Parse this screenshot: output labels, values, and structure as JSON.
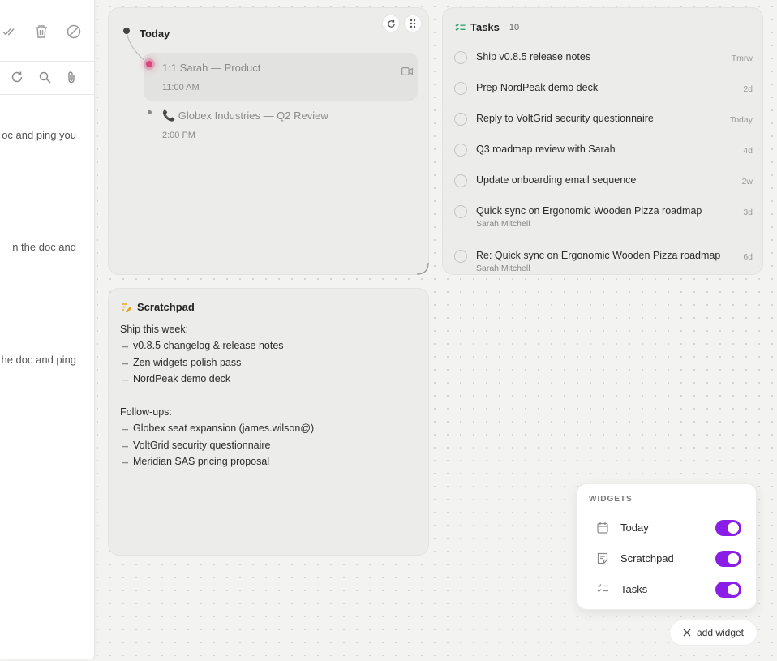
{
  "left_panel": {
    "snippets": [
      "oc and ping you",
      "n the doc and",
      "he doc and ping"
    ],
    "toolbar_icons": [
      "check-all-icon",
      "trash-icon",
      "block-icon",
      "refresh-icon",
      "search-icon",
      "paperclip-icon"
    ]
  },
  "today": {
    "title": "Today",
    "events": [
      {
        "title": "1:1 Sarah — Product",
        "time": "11:00 AM",
        "active": true
      },
      {
        "title": "📞 Globex Industries — Q2 Review",
        "time": "2:00 PM",
        "active": false
      }
    ]
  },
  "tasks": {
    "title": "Tasks",
    "count": "10",
    "items": [
      {
        "label": "Ship v0.8.5 release notes",
        "due": "Tmrw",
        "sub": ""
      },
      {
        "label": "Prep NordPeak demo deck",
        "due": "2d",
        "sub": ""
      },
      {
        "label": "Reply to VoltGrid security questionnaire",
        "due": "Today",
        "sub": ""
      },
      {
        "label": "Q3 roadmap review with Sarah",
        "due": "4d",
        "sub": ""
      },
      {
        "label": "Update onboarding email sequence",
        "due": "2w",
        "sub": ""
      },
      {
        "label": "Quick sync on Ergonomic Wooden Pizza roadmap",
        "due": "3d",
        "sub": "Sarah Mitchell"
      },
      {
        "label": "Re: Quick sync on Ergonomic Wooden Pizza roadmap",
        "due": "6d",
        "sub": "Sarah Mitchell"
      }
    ]
  },
  "scratchpad": {
    "title": "Scratchpad",
    "lines": [
      "Ship this week:",
      "→ v0.8.5 changelog & release notes",
      "→ Zen widgets polish pass",
      "→ NordPeak demo deck",
      "",
      "Follow-ups:",
      "→ Globex seat expansion (james.wilson@)",
      "→ VoltGrid security questionnaire",
      "→ Meridian SAS pricing proposal"
    ]
  },
  "widgets_panel": {
    "heading": "WIDGETS",
    "items": [
      {
        "label": "Today",
        "icon": "calendar-icon",
        "enabled": true
      },
      {
        "label": "Scratchpad",
        "icon": "note-icon",
        "enabled": true
      },
      {
        "label": "Tasks",
        "icon": "checklist-icon",
        "enabled": true
      }
    ]
  },
  "add_widget": {
    "label": "add widget"
  },
  "colors": {
    "toggle_on": "#8b1ee6",
    "active_event_dot": "#d9467e",
    "tasks_icon": "#2aa36b",
    "scratchpad_icon": "#e6a817"
  }
}
